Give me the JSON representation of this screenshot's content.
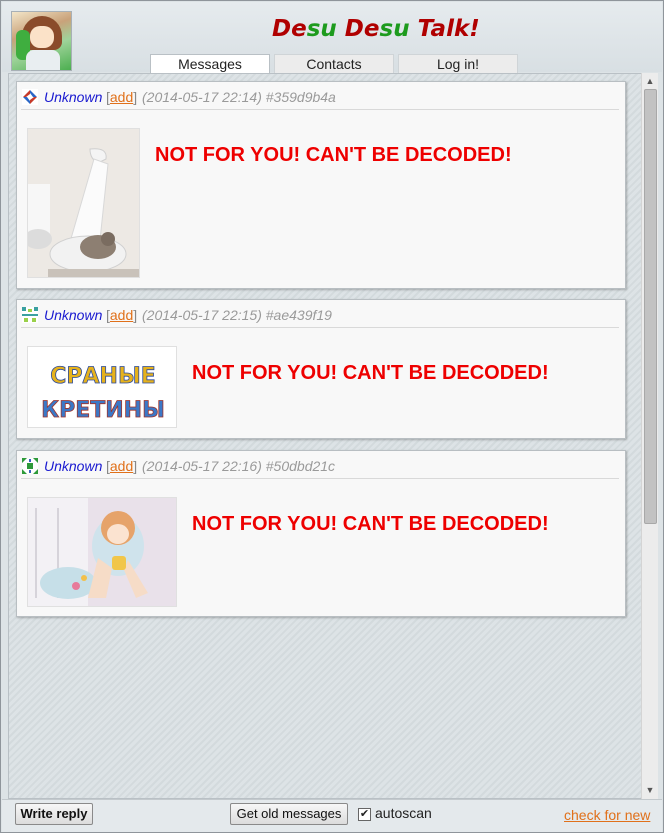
{
  "app": {
    "title_parts": [
      {
        "text": "D",
        "color": "red"
      },
      {
        "text": "e",
        "color": "red"
      },
      {
        "text": "su",
        "color": "green"
      },
      {
        "text": " ",
        "color": "red"
      },
      {
        "text": "De",
        "color": "red"
      },
      {
        "text": "su",
        "color": "green"
      },
      {
        "text": " Talk!",
        "color": "red"
      }
    ],
    "avatar_icon": "anime-girl-with-phone-avatar"
  },
  "tabs": [
    {
      "label": "Messages",
      "active": true
    },
    {
      "label": "Contacts",
      "active": false
    },
    {
      "label": "Log in!",
      "active": false
    }
  ],
  "messages": [
    {
      "author": "Unknown",
      "add_open": "[",
      "add_label": "add",
      "add_close": "]",
      "timestamp": "(2014-05-17 22:14)",
      "hash": "#359d9b4a",
      "image": "cat-in-toilet-paper-photo",
      "text": "NOT FOR YOU! CAN'T BE DECODED!"
    },
    {
      "author": "Unknown",
      "add_open": "[",
      "add_label": "add",
      "add_close": "]",
      "timestamp": "(2014-05-17 22:15)",
      "hash": "#ae439f19",
      "image": "cyrillic-letters-banner",
      "banner_lines": [
        "СРАНЫЕ",
        "КРЕТИНЫ"
      ],
      "text": "NOT FOR YOU! CAN'T BE DECODED!"
    },
    {
      "author": "Unknown",
      "add_open": "[",
      "add_label": "add",
      "add_close": "]",
      "timestamp": "(2014-05-17 22:16)",
      "hash": "#50dbd21c",
      "image": "anime-girl-in-hoodie-drawing",
      "text": "NOT FOR YOU! CAN'T BE DECODED!"
    }
  ],
  "bottom": {
    "write_reply": "Write reply",
    "get_old": "Get old messages",
    "autoscan_checked": true,
    "autoscan_mark": "✔",
    "autoscan_label": "autoscan",
    "check_new": "check for new"
  },
  "colors": {
    "title_red": "#b00000",
    "title_green": "#1d9b1d",
    "author_blue": "#1a1ad0",
    "link_orange": "#e0701a",
    "error_red": "#ee0000"
  }
}
